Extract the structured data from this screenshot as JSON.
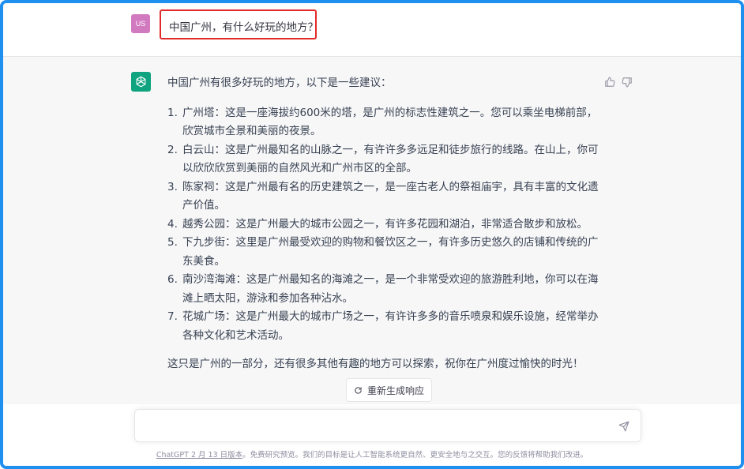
{
  "user_message": {
    "avatar_label": "US",
    "text": "中国广州，有什么好玩的地方？"
  },
  "assistant_message": {
    "intro": "中国广州有很多好玩的地方，以下是一些建议：",
    "items": [
      {
        "num": "1.",
        "text": "广州塔：这是一座海拔约600米的塔，是广州的标志性建筑之一。您可以乘坐电梯前部，欣赏城市全景和美丽的夜景。"
      },
      {
        "num": "2.",
        "text": "白云山：这是广州最知名的山脉之一，有许许多多远足和徒步旅行的线路。在山上，你可以欣欣欣赏到美丽的自然风光和广州市区的全部。"
      },
      {
        "num": "3.",
        "text": "陈家祠：这是广州最有名的历史建筑之一，是一座古老人的祭祖庙宇，具有丰富的文化遗产价值。"
      },
      {
        "num": "4.",
        "text": "越秀公园：这是广州最大的城市公园之一，有许多花园和湖泊，非常适合散步和放松。"
      },
      {
        "num": "5.",
        "text": "下九步街：这里是广州最受欢迎的购物和餐饮区之一，有许多历史悠久的店铺和传统的广东美食。"
      },
      {
        "num": "6.",
        "text": "南沙湾海滩：这是广州最知名的海滩之一，是一个非常受欢迎的旅游胜利地，你可以在海滩上晒太阳，游泳和参加各种沾水。"
      },
      {
        "num": "7.",
        "text": "花城广场：这是广州最大的城市广场之一，有许许多多的音乐喷泉和娱乐设施，经常举办各种文化和艺术活动。"
      }
    ],
    "outro": "这只是广州的一部分，还有很多其他有趣的地方可以探索，祝你在广州度过愉快的时光！"
  },
  "regenerate_label": "重新生成响应",
  "input": {
    "placeholder": "",
    "value": ""
  },
  "footer": {
    "link_text": "ChatGPT 2 月 13 日版本",
    "text": "。免费研究预览。我们的目标是让人工智能系统更自然、更安全地与之交互。您的反馈将帮助我们改进。"
  },
  "colors": {
    "frame": "#1f8ff0",
    "highlight": "#e22a2a",
    "user_avatar": "#d27ac0",
    "gpt_avatar": "#10a37f"
  },
  "icons": {
    "thumbs_up": "thumbs-up-icon",
    "thumbs_down": "thumbs-down-icon",
    "send": "send-icon",
    "refresh": "refresh-icon"
  }
}
